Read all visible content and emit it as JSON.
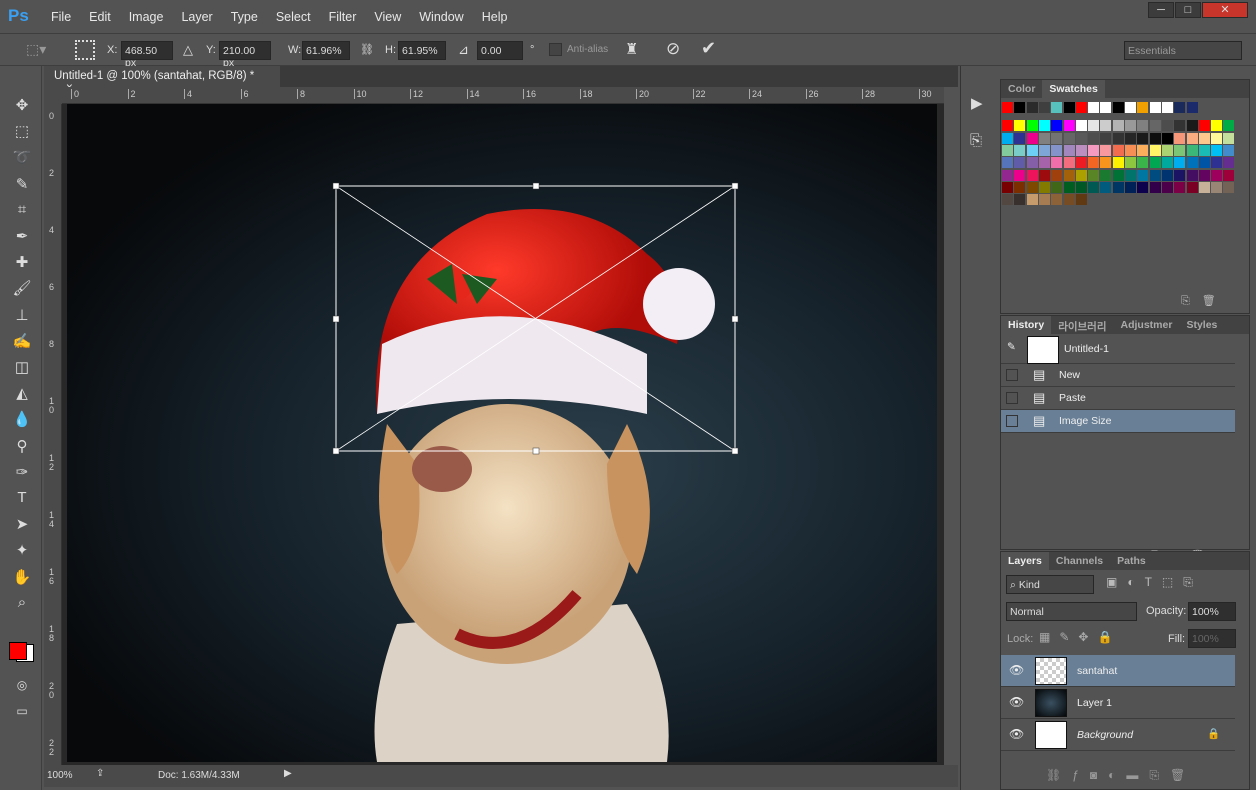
{
  "app": {
    "logo": "Ps",
    "menus": [
      "File",
      "Edit",
      "Image",
      "Layer",
      "Type",
      "Select",
      "Filter",
      "View",
      "Window",
      "Help"
    ],
    "window_buttons": [
      "─",
      "□",
      "✕"
    ]
  },
  "options": {
    "x_label": "X:",
    "x": "468.50 px",
    "y_label": "Y:",
    "y": "210.00 px",
    "w_label": "W:",
    "w": "61.96%",
    "h_label": "H:",
    "h": "61.95%",
    "angle": "0.00",
    "degree": "°",
    "antialias": "Anti-alias",
    "workspace": "Essentials"
  },
  "document": {
    "tab": "Untitled-1 @ 100% (santahat, RGB/8) *",
    "close": "×",
    "zoom": "100%",
    "doc_info": "Doc: 1.63M/4.33M"
  },
  "rulers": {
    "top": [
      "0",
      "2",
      "4",
      "6",
      "8",
      "10",
      "12",
      "14",
      "16",
      "18",
      "20",
      "22",
      "24",
      "26",
      "28",
      "30"
    ],
    "left": [
      "0",
      "2",
      "4",
      "6",
      "8",
      "1\n0",
      "1\n2",
      "1\n4",
      "1\n6",
      "1\n8",
      "2\n0",
      "2\n2"
    ]
  },
  "colors": {
    "foreground": "#ff0000",
    "background": "#ffffff",
    "selected": "#687f96",
    "accent": "#3aa0f3"
  },
  "swatches_panel": {
    "tabs": [
      "Color",
      "Swatches"
    ],
    "colors": [
      "#ff0000",
      "#000000",
      "#2b2b2b",
      "#3f3f3f",
      "#56c1bd",
      "#000000",
      "#ff0000",
      "#ffffff",
      "#ffffff",
      "#000000",
      "#ffffff",
      "#f0a000",
      "#ffffff",
      "#ffffff",
      "#1a2a5a",
      "#1a2a6a",
      "#ff0000",
      "#ffff00",
      "#00ff00",
      "#00ffff",
      "#0000ff",
      "#ff00ff",
      "#ffffff",
      "#e6e6e6",
      "#cccccc",
      "#b3b3b3",
      "#999999",
      "#808080",
      "#666666",
      "#4d4d4d",
      "#333333",
      "#1a1a1a",
      "#ff0000",
      "#ffff00",
      "#00aa44",
      "#00aeef",
      "#2e3192",
      "#ec008c",
      "#808080",
      "#737373",
      "#666666",
      "#595959",
      "#4d4d4d",
      "#404040",
      "#333333",
      "#262626",
      "#1a1a1a",
      "#0d0d0d",
      "#000000",
      "#f7977a",
      "#fbad82",
      "#fdc68c",
      "#fff79a",
      "#c4df9b",
      "#82ca9c",
      "#7accc8",
      "#6dcff6",
      "#7ea7d8",
      "#8493ca",
      "#a187be",
      "#bc8dbf",
      "#f49ac1",
      "#f6989d",
      "#f26c4f",
      "#f68e56",
      "#fbaf5c",
      "#fff467",
      "#acd372",
      "#7cc576",
      "#3bb878",
      "#1abbb4",
      "#00bff3",
      "#438ccb",
      "#5574b9",
      "#605ca8",
      "#855fa8",
      "#a763a9",
      "#f06ea9",
      "#f26d7d",
      "#ed1c24",
      "#f26522",
      "#f7941d",
      "#fff200",
      "#8dc63f",
      "#39b54a",
      "#00a651",
      "#00a99d",
      "#00aeef",
      "#0072bc",
      "#0054a6",
      "#2e3192",
      "#662d91",
      "#92278f",
      "#ec008c",
      "#ed145b",
      "#9e0b0f",
      "#a0410d",
      "#a36209",
      "#aba000",
      "#598527",
      "#1a7b30",
      "#007236",
      "#00746b",
      "#0076a3",
      "#004b80",
      "#003471",
      "#1b1464",
      "#440e62",
      "#630460",
      "#9e005d",
      "#9e0039",
      "#790000",
      "#7b2e00",
      "#7d4900",
      "#827b00",
      "#406618",
      "#005e20",
      "#005826",
      "#005952",
      "#005b7f",
      "#003663",
      "#002157",
      "#0d004c",
      "#32004b",
      "#4b0049",
      "#7b0046",
      "#7a0026",
      "#c7b299",
      "#998675",
      "#736357",
      "#534741",
      "#37302d",
      "#c69c6d",
      "#a67c52",
      "#8c6239",
      "#754c24",
      "#603913"
    ]
  },
  "history_panel": {
    "tabs": [
      "History",
      "라이브러리",
      "Adjustmer",
      "Styles"
    ],
    "snapshot": "Untitled-1",
    "items": [
      "New",
      "Paste",
      "Image Size"
    ]
  },
  "layers_panel": {
    "tabs": [
      "Layers",
      "Channels",
      "Paths"
    ],
    "filter": "Kind",
    "blend": "Normal",
    "opacity_label": "Opacity:",
    "opacity": "100%",
    "lock_label": "Lock:",
    "fill_label": "Fill:",
    "fill": "100%",
    "layers": [
      {
        "name": "santahat",
        "selected": true
      },
      {
        "name": "Layer 1"
      },
      {
        "name": "Background",
        "locked": true
      }
    ]
  }
}
